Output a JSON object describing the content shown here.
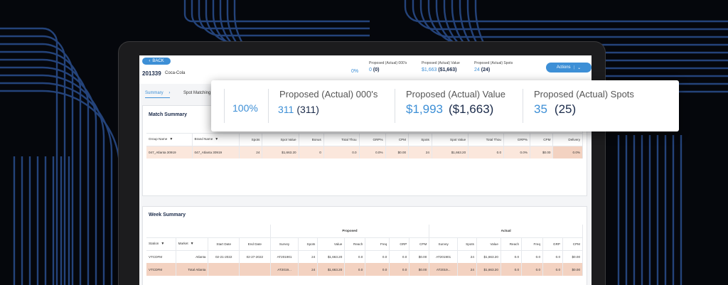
{
  "colors": {
    "accent": "#3d8fd6",
    "navy": "#1b2b4a",
    "highlight": "#fbe7dc",
    "total_row": "#f3d2c1"
  },
  "header": {
    "back_label": "BACK",
    "campaign_id": "201339",
    "campaign_name": "Coca-Cola",
    "pct": "0%",
    "metrics": [
      {
        "label": "Proposed (Actual) 000's",
        "proposed": "0",
        "actual": "(0)"
      },
      {
        "label": "Proposed (Actual) Value",
        "proposed": "$1,663",
        "actual": "($1,663)"
      },
      {
        "label": "Proposed (Actual) Spots",
        "proposed": "24",
        "actual": "(24)"
      }
    ],
    "actions_label": "Actions"
  },
  "tabs": [
    {
      "label": "Summary"
    },
    {
      "label": "Spot Matching"
    }
  ],
  "callout": {
    "pct": "100%",
    "metrics": [
      {
        "label": "Proposed (Actual) 000's",
        "proposed": "311",
        "actual": "(311)"
      },
      {
        "label": "Proposed (Actual) Value",
        "proposed": "$1,993",
        "actual": "($1,663)"
      },
      {
        "label": "Proposed (Actual) Spots",
        "proposed": "35",
        "actual": "(25)"
      }
    ]
  },
  "match_summary": {
    "title": "Match Summary",
    "columns": [
      "Group Name",
      "Brand Name",
      "Spots",
      "Spot Value",
      "Bonus",
      "Total Thou",
      "GRP%",
      "CPM",
      "Spots",
      "Spot Value",
      "Total Thou",
      "GRP%",
      "CPM",
      "Delivery"
    ],
    "rows": [
      [
        "047_Atlanta 30919",
        "047_Atlanta 30919",
        "24",
        "$1,663.20",
        "0",
        "0.0",
        "0.0%",
        "$0.00",
        "24",
        "$1,663.20",
        "0.0",
        "0.0%",
        "$0.00",
        "0.0%"
      ]
    ]
  },
  "week_summary": {
    "title": "Week Summary",
    "group_proposed": "Proposed",
    "group_actual": "Actual",
    "columns": [
      "Station",
      "Market",
      "Start Date",
      "End Date",
      "Survey",
      "Spots",
      "Value",
      "Reach",
      "Freq",
      "GRP",
      "CPM",
      "Survey",
      "Spots",
      "Value",
      "Reach",
      "Freq",
      "GRP",
      "CPM"
    ],
    "rows": [
      [
        "VTCDFM",
        "Atlanta",
        "02-21-2022",
        "02-27-2022",
        "AT201901",
        "24",
        "$1,663.20",
        "0.0",
        "0.0",
        "0.0",
        "$0.00",
        "AT201901",
        "24",
        "$1,663.20",
        "0.0",
        "0.0",
        "0.0",
        "$0.00"
      ],
      [
        "VTCDFM",
        "Total Atlanta",
        "",
        "",
        "AT2019...",
        "24",
        "$1,663.20",
        "0.0",
        "0.0",
        "0.0",
        "$0.00",
        "AT2019...",
        "24",
        "$1,663.20",
        "0.0",
        "0.0",
        "0.0",
        "$0.00"
      ]
    ]
  }
}
